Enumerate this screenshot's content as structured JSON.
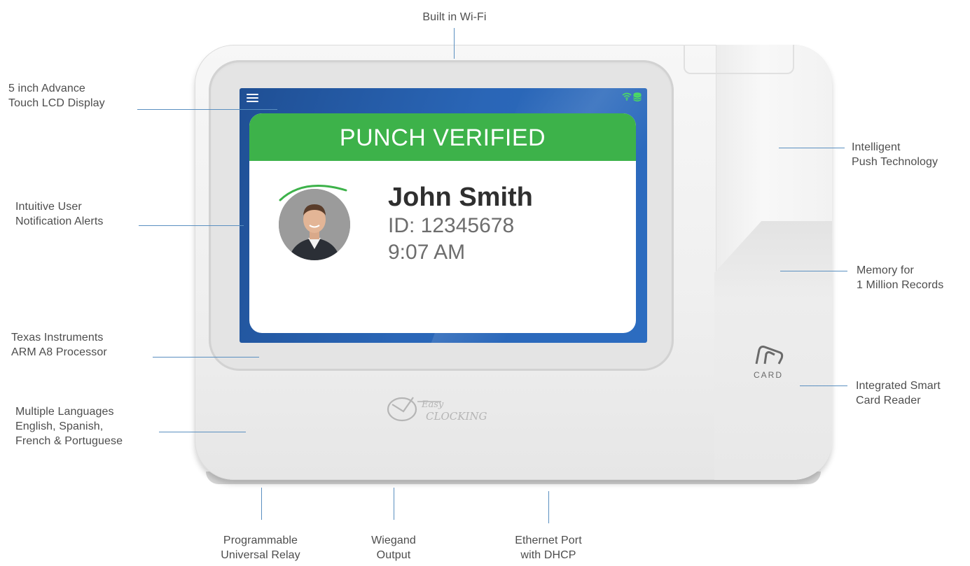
{
  "annotations": {
    "wifi": [
      "Built in Wi-Fi"
    ],
    "display": [
      "5 inch Advance",
      "Touch LCD Display"
    ],
    "alerts": [
      "Intuitive User",
      "Notification Alerts"
    ],
    "processor": [
      "Texas Instruments",
      "ARM A8 Processor"
    ],
    "languages": [
      "Multiple Languages",
      "English, Spanish,",
      "French & Portuguese"
    ],
    "push": [
      "Intelligent",
      "Push Technology"
    ],
    "memory": [
      "Memory for",
      "1 Million Records"
    ],
    "smartcard": [
      "Integrated Smart",
      "Card Reader"
    ],
    "relay": [
      "Programmable",
      "Universal Relay"
    ],
    "wiegand": [
      "Wiegand",
      "Output"
    ],
    "ethernet": [
      "Ethernet Port",
      "with DHCP"
    ]
  },
  "screen": {
    "header": "PUNCH VERIFIED",
    "name": "John Smith",
    "id": "ID: 12345678",
    "time": "9:07 AM"
  },
  "device": {
    "card_label": "CARD"
  },
  "colors": {
    "leader_line": "#5a8fc0",
    "screen_blue": "#2a66b7",
    "verified_green": "#3db24a",
    "status_icon_green": "#4cd964"
  },
  "icons": [
    "menu-icon",
    "wifi-icon",
    "database-icon",
    "easy-clocking-logo",
    "card-reader-icon"
  ]
}
